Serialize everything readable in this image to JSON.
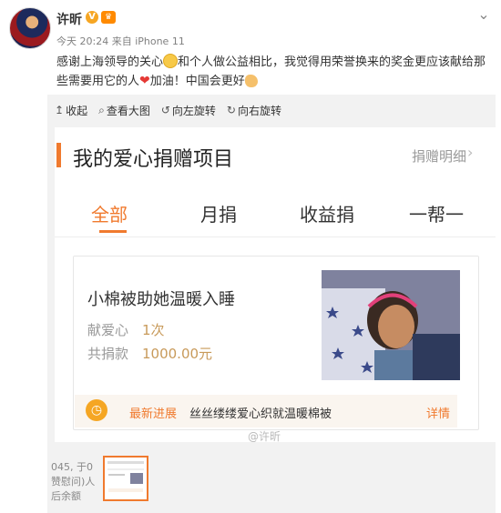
{
  "post": {
    "username": "许昕",
    "verified_badge": "V",
    "vip_badge": "crown-icon",
    "meta": "今天 20:24 来自 iPhone 11",
    "text_part1": "感谢上海领导的关心",
    "text_part2": "和个人做公益相比，我觉得用荣誉换来的奖金更应该献给那些需要用它的人",
    "text_part3": "加油！中国会更好"
  },
  "toolbar": {
    "collapse": "收起",
    "view_large": "查看大图",
    "rotate_left": "向左旋转",
    "rotate_right": "向右旋转"
  },
  "card": {
    "title": "我的爱心捐赠项目",
    "donate_detail": "捐赠明细",
    "tabs": [
      "全部",
      "月捐",
      "收益捐",
      "一帮一"
    ],
    "active_tab": "全部",
    "item": {
      "title": "小棉被助她温暖入睡",
      "love_label": "献爱心",
      "love_value": "1次",
      "total_label": "共捐款",
      "total_value": "1000.00元",
      "progress_label": "最新进展",
      "progress_text": "丝丝缕缕爱心织就温暖棉被",
      "detail": "详情"
    },
    "watermark": "@许昕"
  },
  "thumbnail_strip": {
    "text_lines": [
      "045, 于0",
      "赞慰问)人",
      "后余额"
    ]
  },
  "colors": {
    "accent": "#f07a2e",
    "gold": "#c89a5a",
    "panel_bg": "#f2f2f2"
  }
}
